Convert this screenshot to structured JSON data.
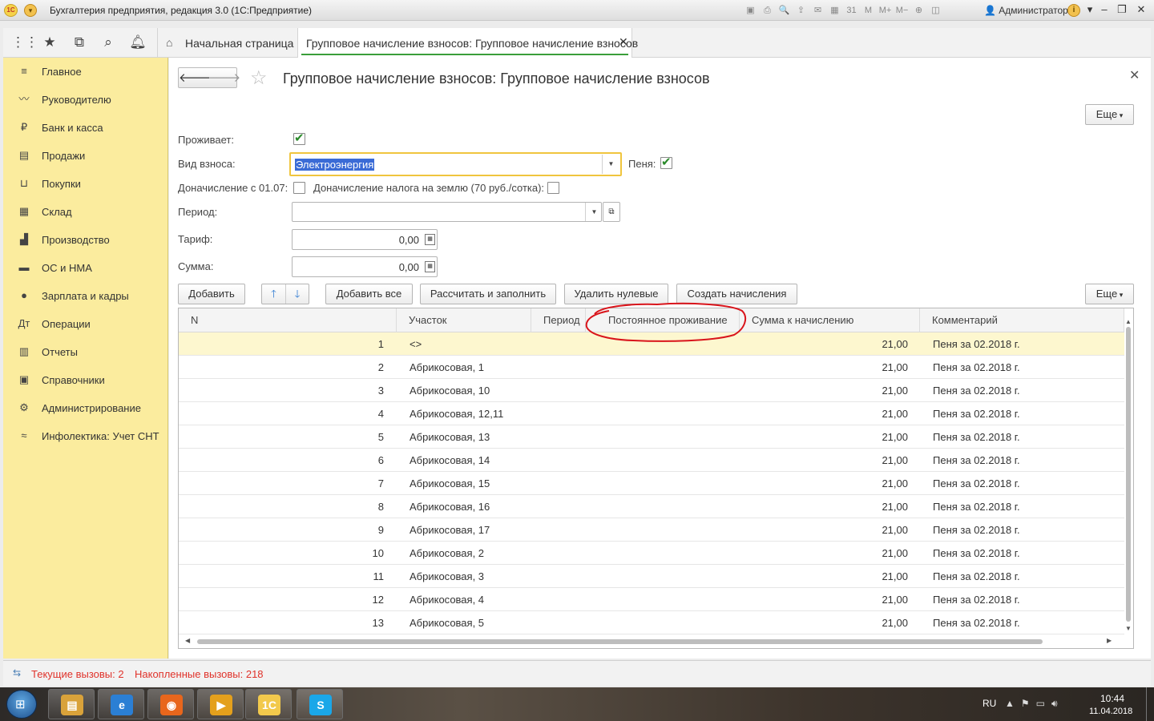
{
  "window": {
    "title": "Бухгалтерия предприятия, редакция 3.0  (1С:Предприятие)",
    "user": "Администратор",
    "logo": "1С",
    "toolbar_icons": [
      "save-icon",
      "print-icon",
      "preview-icon",
      "upload-icon",
      "mail-icon",
      "table-icon",
      "calendar-icon",
      "memory-m-icon",
      "memory-plus-icon",
      "memory-minus-icon",
      "zoom-icon",
      "panel-icon"
    ],
    "toolbar_glyphs": [
      "▣",
      "⎙",
      "🔍",
      "⇪",
      "✉",
      "▦",
      "31",
      "M",
      "M+",
      "M−",
      "⊕",
      "◫"
    ]
  },
  "tabs": {
    "home": "Начальная страница",
    "active": "Групповое начисление взносов: Групповое начисление взносов"
  },
  "sidebar": {
    "items": [
      {
        "label": "Главное",
        "icon": "menu-icon",
        "glyph": "≡"
      },
      {
        "label": "Руководителю",
        "icon": "trend-icon",
        "glyph": "〰"
      },
      {
        "label": "Банк и касса",
        "icon": "ruble-icon",
        "glyph": "₽"
      },
      {
        "label": "Продажи",
        "icon": "bag-icon",
        "glyph": "▤"
      },
      {
        "label": "Покупки",
        "icon": "cart-icon",
        "glyph": "⊔"
      },
      {
        "label": "Склад",
        "icon": "warehouse-icon",
        "glyph": "▦"
      },
      {
        "label": "Производство",
        "icon": "factory-icon",
        "glyph": "▟"
      },
      {
        "label": "ОС и НМА",
        "icon": "truck-icon",
        "glyph": "▬"
      },
      {
        "label": "Зарплата и кадры",
        "icon": "person-icon",
        "glyph": "●"
      },
      {
        "label": "Операции",
        "icon": "operations-icon",
        "glyph": "Дт"
      },
      {
        "label": "Отчеты",
        "icon": "reports-icon",
        "glyph": "▥"
      },
      {
        "label": "Справочники",
        "icon": "book-icon",
        "glyph": "▣"
      },
      {
        "label": "Администрирование",
        "icon": "gear-icon",
        "glyph": "⚙"
      },
      {
        "label": "Инфолектика: Учет СНТ",
        "icon": "infolectica-icon",
        "glyph": "≈"
      }
    ]
  },
  "form": {
    "title": "Групповое начисление взносов: Групповое начисление взносов",
    "more_label": "Еще",
    "lives_label": "Проживает:",
    "lives_checked": true,
    "fee_type_label": "Вид взноса:",
    "fee_type_value": "Электроэнергия",
    "penalty_label": "Пеня:",
    "penalty_checked": true,
    "extra_from_label": "Доначисление с 01.07:",
    "extra_from_checked": false,
    "land_tax_label": "Доначисление налога на землю (70 руб./сотка):",
    "land_tax_checked": false,
    "period_label": "Период:",
    "period_value": "",
    "tariff_label": "Тариф:",
    "tariff_value": "0,00",
    "sum_label": "Сумма:",
    "sum_value": "0,00"
  },
  "table_toolbar": {
    "add": "Добавить",
    "add_all": "Добавить все",
    "calc_fill": "Рассчитать и заполнить",
    "delete_zero": "Удалить нулевые",
    "create_charges": "Создать начисления",
    "more": "Еще"
  },
  "table": {
    "columns": [
      "N",
      "Участок",
      "Период",
      "Постоянное проживание",
      "Сумма к начислению",
      "Комментарий"
    ],
    "rows": [
      {
        "n": "1",
        "plot": "<>",
        "period": "",
        "permanent": "",
        "amount": "21,00",
        "comment": "Пеня за 02.2018 г."
      },
      {
        "n": "2",
        "plot": "Абрикосовая, 1",
        "period": "",
        "permanent": "",
        "amount": "21,00",
        "comment": "Пеня за 02.2018 г."
      },
      {
        "n": "3",
        "plot": "Абрикосовая, 10",
        "period": "",
        "permanent": "",
        "amount": "21,00",
        "comment": "Пеня за 02.2018 г."
      },
      {
        "n": "4",
        "plot": "Абрикосовая, 12,11",
        "period": "",
        "permanent": "",
        "amount": "21,00",
        "comment": "Пеня за 02.2018 г."
      },
      {
        "n": "5",
        "plot": "Абрикосовая, 13",
        "period": "",
        "permanent": "",
        "amount": "21,00",
        "comment": "Пеня за 02.2018 г."
      },
      {
        "n": "6",
        "plot": "Абрикосовая, 14",
        "period": "",
        "permanent": "",
        "amount": "21,00",
        "comment": "Пеня за 02.2018 г."
      },
      {
        "n": "7",
        "plot": "Абрикосовая, 15",
        "period": "",
        "permanent": "",
        "amount": "21,00",
        "comment": "Пеня за 02.2018 г."
      },
      {
        "n": "8",
        "plot": "Абрикосовая, 16",
        "period": "",
        "permanent": "",
        "amount": "21,00",
        "comment": "Пеня за 02.2018 г."
      },
      {
        "n": "9",
        "plot": "Абрикосовая, 17",
        "period": "",
        "permanent": "",
        "amount": "21,00",
        "comment": "Пеня за 02.2018 г."
      },
      {
        "n": "10",
        "plot": "Абрикосовая, 2",
        "period": "",
        "permanent": "",
        "amount": "21,00",
        "comment": "Пеня за 02.2018 г."
      },
      {
        "n": "11",
        "plot": "Абрикосовая, 3",
        "period": "",
        "permanent": "",
        "amount": "21,00",
        "comment": "Пеня за 02.2018 г."
      },
      {
        "n": "12",
        "plot": "Абрикосовая, 4",
        "period": "",
        "permanent": "",
        "amount": "21,00",
        "comment": "Пеня за 02.2018 г."
      },
      {
        "n": "13",
        "plot": "Абрикосовая, 5",
        "period": "",
        "permanent": "",
        "amount": "21,00",
        "comment": "Пеня за 02.2018 г."
      }
    ]
  },
  "status": {
    "current_calls": "Текущие вызовы: 2",
    "accumulated_calls": "Накопленные вызовы: 218"
  },
  "taskbar": {
    "apps": [
      {
        "name": "explorer-icon",
        "glyph": "▤",
        "color": "#d9a23a"
      },
      {
        "name": "ie-icon",
        "glyph": "e",
        "color": "#2b7fd4"
      },
      {
        "name": "firefox-icon",
        "glyph": "◉",
        "color": "#e8661c"
      },
      {
        "name": "media-player-icon",
        "glyph": "▶",
        "color": "#e4a01c"
      },
      {
        "name": "1c-icon",
        "glyph": "1С",
        "color": "#f2c94c"
      },
      {
        "name": "skype-icon",
        "glyph": "S",
        "color": "#1aa7e8"
      }
    ],
    "lang": "RU",
    "time": "10:44",
    "date": "11.04.2018"
  },
  "colors": {
    "sidebar_bg": "#fbec9e",
    "current_row": "#fdf7cf",
    "focus_border": "#f0c53e",
    "status_text": "#e0332b",
    "annotation": "#d9141b"
  }
}
